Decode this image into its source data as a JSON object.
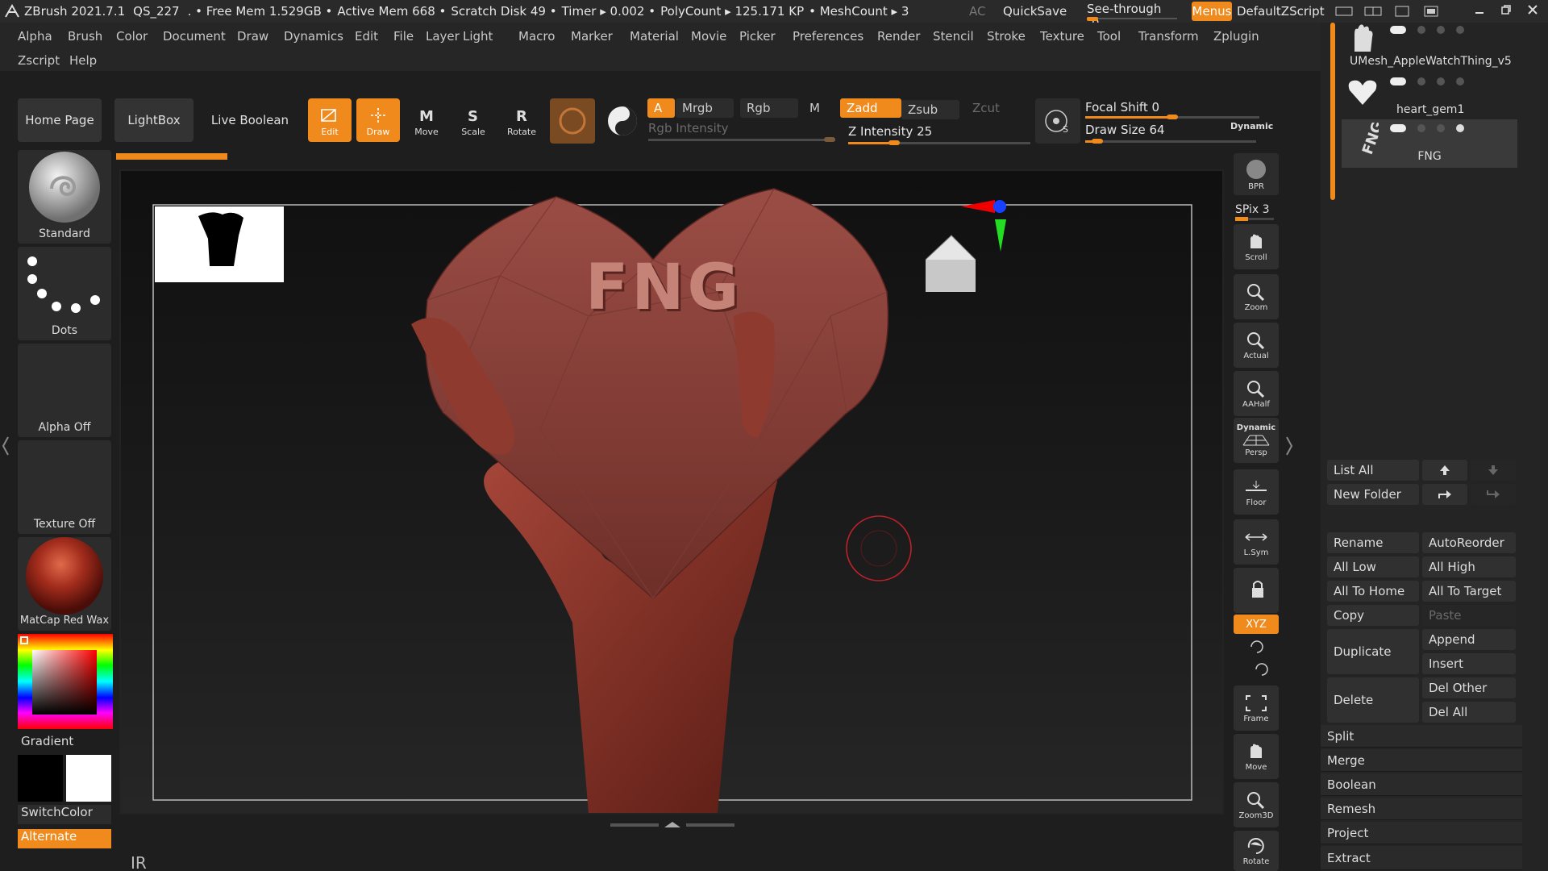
{
  "titlebar": {
    "app": "ZBrush 2021.7.1",
    "doc": "QS_227",
    "free_mem": ". • Free Mem 1.529GB •",
    "active_mem": "Active Mem 668 •",
    "scratch": "Scratch Disk 49 •",
    "timer": "Timer ▸ 0.002 •",
    "polycount": "PolyCount ▸ 125.171 KP",
    "meshcount": "• MeshCount ▸ 3",
    "ac": "AC",
    "quicksave": "QuickSave",
    "seethrough_label": "See-through",
    "seethrough_value": "0",
    "menus": "Menus",
    "default_zscript": "DefaultZScript"
  },
  "menu": {
    "row1": [
      "Alpha",
      "Brush",
      "Color",
      "Document",
      "Draw",
      "Dynamics",
      "Edit",
      "File",
      "Layer",
      "Light",
      "Macro",
      "Marker",
      "Material",
      "Movie",
      "Picker",
      "Preferences",
      "Render",
      "Stencil",
      "Stroke",
      "Texture",
      "Tool",
      "Transform",
      "Zplugin"
    ],
    "row2": [
      "Zscript",
      "Help"
    ]
  },
  "toolbar": {
    "home_page": "Home Page",
    "lightbox": "LightBox",
    "live_boolean": "Live Boolean",
    "edit": "Edit",
    "draw": "Draw",
    "move": "Move",
    "scale": "Scale",
    "rotate": "Rotate",
    "a": "A",
    "mrgb": "Mrgb",
    "rgb": "Rgb",
    "m": "M",
    "zadd": "Zadd",
    "zsub": "Zsub",
    "zcut": "Zcut",
    "rgb_intensity": "Rgb Intensity",
    "z_intensity": "Z Intensity 25",
    "z_intensity_level": 0.25,
    "focal_shift": "Focal Shift 0",
    "focal_shift_level": 0.5,
    "draw_size": "Draw Size 64",
    "draw_size_level": 0.07,
    "dynamic": "Dynamic",
    "accent": "#f08a1c"
  },
  "shelf": {
    "brush": "Standard",
    "stroke": "Dots",
    "alpha": "Alpha Off",
    "texture": "Texture Off",
    "material": "MatCap Red Wax",
    "gradient": "Gradient",
    "switchcolor": "SwitchColor",
    "alternate": "Alternate"
  },
  "canvas": {
    "heart_text": "FNG",
    "cursor_icon": "brush-circle-icon",
    "bottom_text": "IR",
    "model_color": "#8a3a30"
  },
  "side": {
    "bpr": "BPR",
    "spix": "SPix 3",
    "scroll": "Scroll",
    "zoom": "Zoom",
    "actual": "Actual",
    "aahalf": "AAHalf",
    "dynamic": "Dynamic",
    "persp": "Persp",
    "floor": "Floor",
    "lsym": "L.Sym",
    "xyz": "XYZ",
    "frame": "Frame",
    "move": "Move",
    "zoom3d": "Zoom3D",
    "rotate": "Rotate"
  },
  "subtool": {
    "items": [
      "UMesh_AppleWatchThing_v5",
      "heart_gem1",
      "FNG"
    ],
    "list_all": "List All",
    "new_folder": "New Folder",
    "rename": "Rename",
    "autoreorder": "AutoReorder",
    "all_low": "All Low",
    "all_high": "All High",
    "all_to_home": "All To Home",
    "all_to_target": "All To Target",
    "copy": "Copy",
    "paste": "Paste",
    "duplicate": "Duplicate",
    "append": "Append",
    "insert": "Insert",
    "delete": "Delete",
    "del_other": "Del Other",
    "del_all": "Del All",
    "split": "Split",
    "merge": "Merge",
    "boolean": "Boolean",
    "remesh": "Remesh",
    "project": "Project",
    "extract": "Extract"
  }
}
